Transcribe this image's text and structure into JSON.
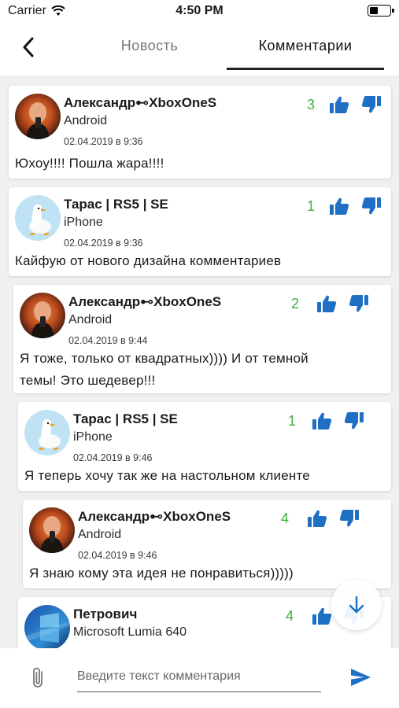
{
  "status": {
    "carrier": "Carrier",
    "time": "4:50 PM"
  },
  "nav": {
    "tab_news": "Новость",
    "tab_comments": "Комментарии"
  },
  "colors": {
    "accent_blue": "#1f6fc4",
    "score_green": "#3fae3f",
    "tab_active": "#222222"
  },
  "comments": [
    {
      "author": "Александр⊷XboxOneS",
      "device": "Android",
      "date": "02.04.2019 в 9:36",
      "score": "3",
      "text": [
        "Юхоу!!!! Пошла жара!!!!"
      ],
      "avatar": "photo-avatar"
    },
    {
      "author": "Тарас | RS5 | SE",
      "device": "iPhone",
      "date": "02.04.2019 в 9:36",
      "score": "1",
      "text": [
        "Кайфую от нового дизайна комментариев"
      ],
      "avatar": "goose-avatar"
    },
    {
      "author": "Александр⊷XboxOneS",
      "device": "Android",
      "date": "02.04.2019 в 9:44",
      "score": "2",
      "text": [
        "Я тоже, только от квадратных)))) И от темной",
        "темы! Это шедевер!!!"
      ],
      "avatar": "photo-avatar"
    },
    {
      "author": "Тарас | RS5 | SE",
      "device": "iPhone",
      "date": "02.04.2019 в 9:46",
      "score": "1",
      "text": [
        "Я теперь хочу так же на настольном клиенте"
      ],
      "avatar": "goose-avatar"
    },
    {
      "author": "Александр⊷XboxOneS",
      "device": "Android",
      "date": "02.04.2019 в 9:46",
      "score": "4",
      "text": [
        "Я знаю кому эта идея не понравиться)))))"
      ],
      "avatar": "photo-avatar"
    },
    {
      "author": "Петрович",
      "device": "Microsoft Lumia 640",
      "score": "4",
      "avatar": "windows-avatar"
    }
  ],
  "composer": {
    "placeholder": "Введите текст комментария"
  },
  "icons": {
    "back": "chevron-left-icon",
    "like": "thumbs-up-icon",
    "dislike": "thumbs-down-icon",
    "scroll_down": "arrow-down-icon",
    "attach": "paperclip-icon",
    "send": "send-icon"
  }
}
